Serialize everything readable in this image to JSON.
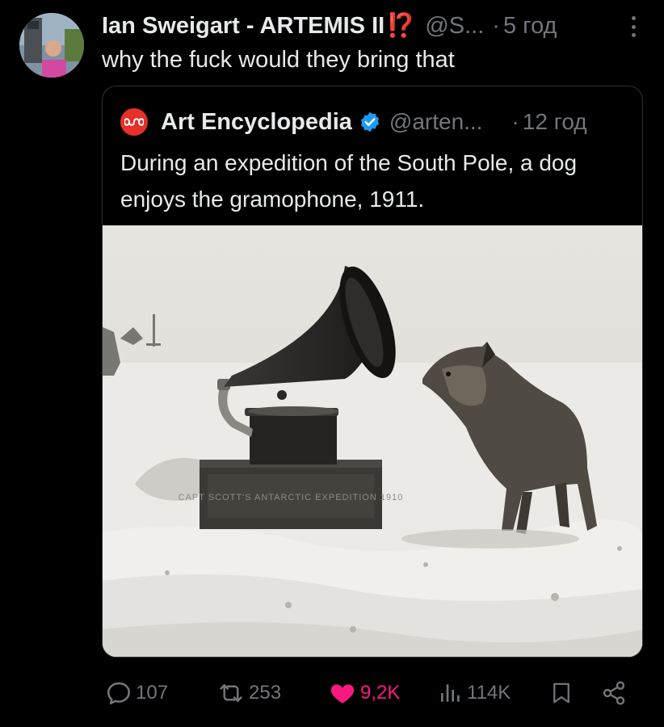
{
  "post": {
    "author_name": "Ian Sweigart - ARTEMIS II",
    "emoji": "⁉️",
    "handle": "@S...",
    "separator": "·",
    "time": "5 год",
    "text": "why the fuck would they bring that"
  },
  "quote": {
    "author_name": "Art Encyclopedia",
    "handle": "@arten...",
    "separator": "·",
    "time": "12 год",
    "text": "During an expedition of the South Pole, a dog enjoys the gramophone, 1911.",
    "image_box_text": "CAPT SCOTT'S ANTARCTIC EXPEDITION 1910"
  },
  "actions": {
    "replies": "107",
    "reposts": "253",
    "likes": "9,2K",
    "views": "114K"
  },
  "colors": {
    "background": "#000000",
    "text": "#e7e9ea",
    "muted": "#71767b",
    "like": "#f91880",
    "verified": "#1d9bf0",
    "brand_red": "#e5312a"
  },
  "icons": [
    "more-vertical-icon",
    "verified-badge-icon",
    "reply-icon",
    "repost-icon",
    "heart-icon",
    "views-icon",
    "bookmark-icon",
    "share-icon"
  ]
}
